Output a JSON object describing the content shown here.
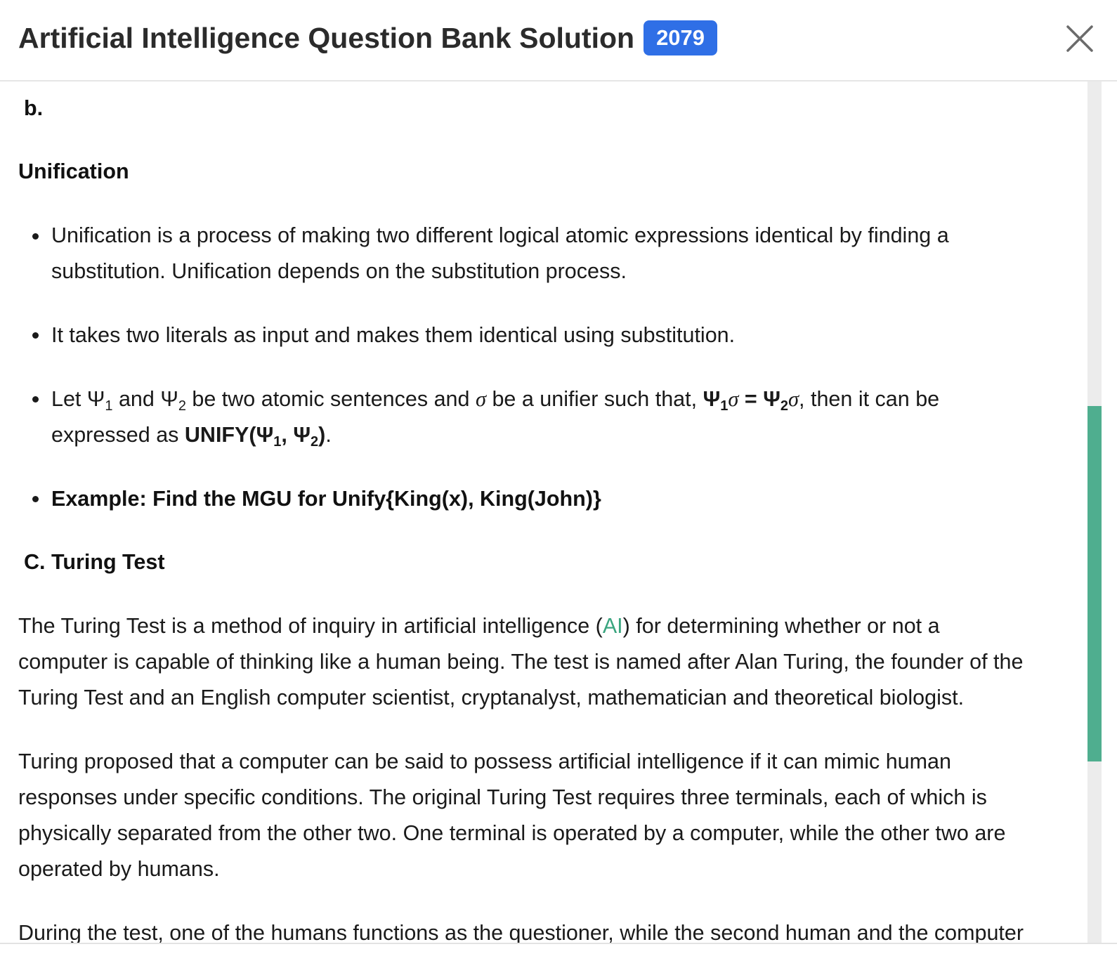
{
  "header": {
    "title": "Artificial Intelligence Question Bank Solution",
    "badge": "2079",
    "close_icon": "close-icon"
  },
  "content": {
    "part_b_label": "b.",
    "unification_heading": "Unification",
    "bullets": {
      "b1_line1": "Unification is a process of making two different logical atomic expressions identical by finding a",
      "b1_line2": "substitution. Unification depends on the substitution process.",
      "b2": "It takes two literals as input and makes them identical using substitution.",
      "b3": {
        "let": "Let ",
        "psi": "Ψ",
        "sub1": "1",
        "and": " and ",
        "sub2": "2",
        "mid": " be two atomic sentences and ",
        "sigma": "σ",
        "mid2": " be a unifier such that, ",
        "eq": " = ",
        "tail": ", then it can be",
        "line2_prefix": "expressed as ",
        "unify_open": "UNIFY(",
        "comma": ", ",
        "close_paren": ")",
        "period": "."
      },
      "b4": "Example: Find the MGU for Unify{King(x), King(John)}"
    },
    "turing_heading": "C. Turing Test",
    "p1": {
      "line1_pre": "The Turing Test is a method of inquiry in artificial intelligence (",
      "ai_link": "AI",
      "line1_post": ") for determining whether or not a",
      "line2": "computer is capable of thinking like a human being. The test is named after Alan Turing, the founder of the",
      "line3": "Turing Test and an English computer scientist, cryptanalyst, mathematician and theoretical biologist."
    },
    "p2": {
      "line1": "Turing proposed that a computer can be said to possess artificial intelligence if it can mimic human",
      "line2": "responses under specific conditions. The original Turing Test requires three terminals, each of which is",
      "line3": "physically separated from the other two. One terminal is operated by a computer, while the other two are",
      "line4": "operated by humans."
    },
    "p3_line1": "During the test, one of the humans functions as the questioner, while the second human and the computer"
  },
  "colors": {
    "badge_bg": "#2f6fe6",
    "link": "#3aa57f",
    "scroll_thumb": "#4fae8f"
  }
}
